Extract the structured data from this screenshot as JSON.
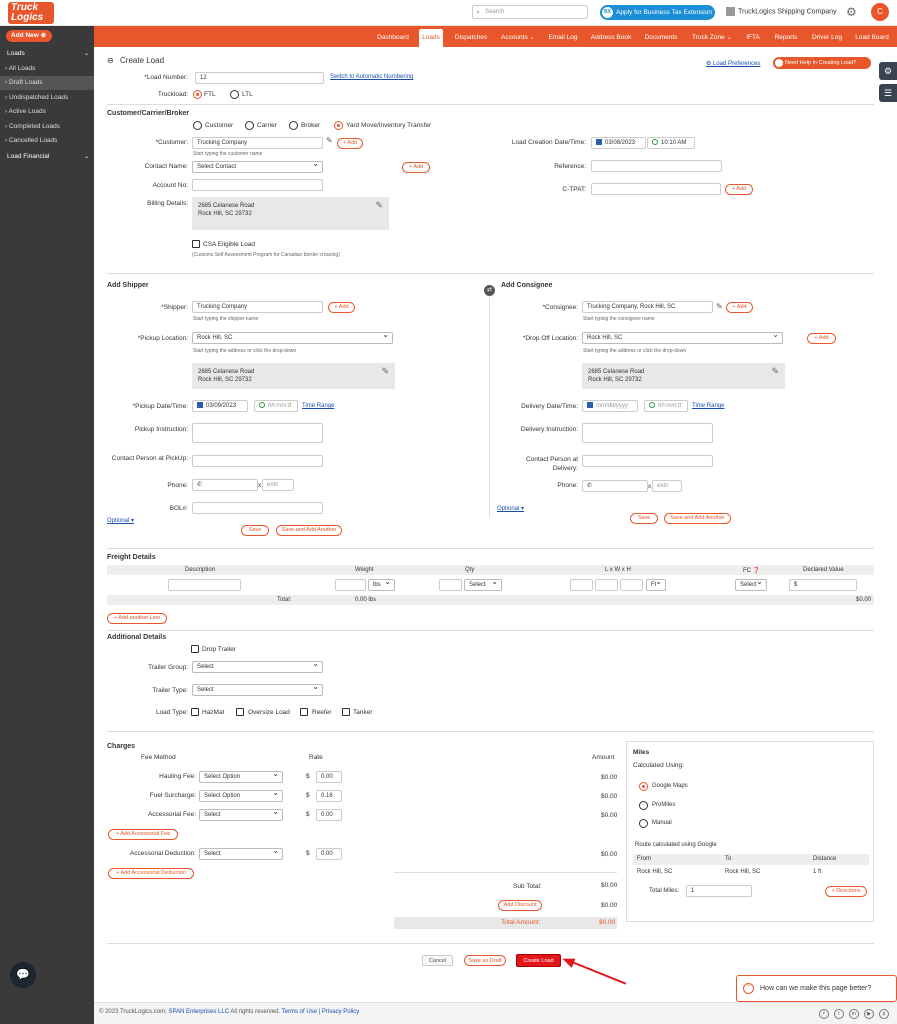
{
  "topbar": {
    "logo": "Truck Logics",
    "search_placeholder": "Search",
    "tax_badge": "BX",
    "tax_button": "Apply for Business Tax Extension",
    "company": "TruckLogics Shipping Company",
    "avatar": "C"
  },
  "sidebar": {
    "add_new": "Add New",
    "items": [
      {
        "label": "Loads",
        "type": "hdr"
      },
      {
        "label": "All Loads",
        "type": "sub"
      },
      {
        "label": "Draft Loads",
        "type": "active"
      },
      {
        "label": "Undispatched Loads",
        "type": "sub"
      },
      {
        "label": "Active Loads",
        "type": "sub"
      },
      {
        "label": "Completed Loads",
        "type": "sub"
      },
      {
        "label": "Cancelled Loads",
        "type": "sub"
      },
      {
        "label": "Load Financial",
        "type": "hdr"
      }
    ]
  },
  "nav": [
    "Dashboard",
    "Loads",
    "Dispatches",
    "Accounts",
    "Email Log",
    "Address Book",
    "Documents",
    "Truck Zone",
    "IFTA",
    "Reports",
    "Driver Log",
    "Load Board"
  ],
  "header": {
    "title": "Create Load",
    "load_prefs": "Load Preferences",
    "help": "Need Help In Creating Load?"
  },
  "load": {
    "number_label": "*Load Number:",
    "number": "12",
    "auto_numbering": "Switch to Automatic Numbering",
    "truckload_label": "Truckload:",
    "ftl": "FTL",
    "ltl": "LTL"
  },
  "customer": {
    "section": "Customer/Carrier/Broker",
    "opt_customer": "Customer",
    "opt_carrier": "Carrier",
    "opt_broker": "Broker",
    "opt_yard": "Yard Move/Inventory Transfer",
    "customer_label": "*Customer:",
    "customer_value": "Trucking Company",
    "customer_hint": "Start typing the customer name",
    "add": "+ Add",
    "contact_label": "Contact Name:",
    "contact_value": "Select Contact",
    "account_label": "Account No:",
    "billing_label": "Billing Details:",
    "billing_l1": "2685 Celanese Road",
    "billing_l2": "Rock Hill, SC 29732",
    "csa_label": "CSA Eligible Load",
    "csa_hint": "(Customs Self Assessment Program for Canadian border crossing)",
    "created_label": "Load Creation Date/Time:",
    "created_date": "03/08/2023",
    "created_time": "10:10 AM",
    "reference_label": "Reference:",
    "ctpat_label": "C-TPAT:"
  },
  "shipper": {
    "section": "Add Shipper",
    "shipper_label": "*Shipper:",
    "shipper_value": "Trucking Company",
    "shipper_hint": "Start typing the shipper name",
    "loc_label": "*Pickup Location:",
    "loc_value": "Rock Hill, SC",
    "loc_hint": "Start typing the address or click the drop-down",
    "addr_l1": "2685 Celanese Road",
    "addr_l2": "Rock Hill, SC 29732",
    "date_label": "*Pickup Date/Time:",
    "date_value": "03/09/2023",
    "time_ph": "hh:mm:tt",
    "time_range": "Time Range",
    "instr_label": "Pickup Instruction:",
    "contact_label": "Contact Person at PickUp:",
    "phone_label": "Phone:",
    "x": "x",
    "ext_ph": "extn",
    "bol_label": "BOL#:",
    "optional": "Optional",
    "save": "Save",
    "save_another": "Save and Add Another"
  },
  "consignee": {
    "section": "Add Consignee",
    "cons_label": "*Consignee:",
    "cons_value": "Trucking Company, Rock Hill, SC",
    "cons_hint": "Start typing the consignee name",
    "loc_label": "*Drop Off Location:",
    "loc_value": "Rock Hill, SC",
    "loc_hint": "Start typing the address or click the drop-down",
    "addr_l1": "2685 Celanese Road",
    "addr_l2": "Rock Hill, SC 29732",
    "date_label": "Delivery Date/Time:",
    "date_ph": "mm/dd/yyyy",
    "time_ph": "hh:mm:tt",
    "time_range": "Time Range",
    "instr_label": "Delivery Instruction:",
    "contact_label1": "Contact Person at",
    "contact_label2": "Delivery:",
    "phone_label": "Phone:",
    "x": "x",
    "ext_ph": "extn",
    "optional": "Optional",
    "save": "Save",
    "save_another": "Save and Add Another"
  },
  "freight": {
    "section": "Freight Details",
    "cols": [
      "Description",
      "Weight",
      "Qty",
      "L x W x H",
      "FC",
      "Declared Value"
    ],
    "weight_unit": "lbs",
    "qty_select": "Select",
    "dim_unit": "Ft",
    "fc_select": "Select",
    "dollar": "$",
    "total_label": "Total:",
    "total_weight": "0.00 lbs",
    "total_value": "$0.00",
    "add_line": "+ Add another Line"
  },
  "additional": {
    "section": "Additional Details",
    "drop_trailer": "Drop Trailer",
    "trailer_group_label": "Trailer Group:",
    "trailer_group": "Select",
    "trailer_type_label": "Trailer Type:",
    "trailer_type": "Select",
    "load_type_label": "Load Type:",
    "types": [
      "HazMat",
      "Oversize Load",
      "Reefer",
      "Tanker"
    ]
  },
  "charges": {
    "section": "Charges",
    "fee_method": "Fee Method",
    "rate": "Rate",
    "amount": "Amount",
    "rows": [
      {
        "label": "Hauling Fee:",
        "method": "Select Option",
        "rate": "0.00",
        "amount": "$0.00"
      },
      {
        "label": "Fuel Surcharge:",
        "method": "Select Option",
        "rate": "0.16",
        "amount": "$0.00"
      },
      {
        "label": "Accessorial Fee:",
        "method": "Select",
        "rate": "0.00",
        "amount": "$0.00"
      },
      {
        "label": "Accessorial Deduction:",
        "method": "Select",
        "rate": "0.00",
        "amount": "$0.00"
      }
    ],
    "add_fee": "+ Add Accessorial Fee",
    "add_deduction": "+ Add Accessorial Deduction",
    "dollar": "$",
    "subtotal_label": "Sub Total:",
    "subtotal": "$0.00",
    "add_discount": "Add Discount",
    "discount": "$0.00",
    "total_label": "Total Amount:",
    "total": "$0.00"
  },
  "miles": {
    "title": "Miles",
    "calc": "Calculated Using:",
    "opts": [
      "Google Maps",
      "ProMiles",
      "Manual"
    ],
    "route": "Route calculated using Google",
    "cols": [
      "From",
      "To",
      "Distance"
    ],
    "from": "Rock Hill, SC",
    "to": "Rock Hill, SC",
    "distance": "1 ft",
    "total_label": "Total Miles:",
    "total": "1",
    "directions": "Directions"
  },
  "actions": {
    "cancel": "Cancel",
    "draft": "Save as Draft",
    "create": "Create Load"
  },
  "footer": {
    "copy": "© 2023 TruckLogics.com,",
    "span": "SPAN Enterprises LLC",
    "rights": "All rights reserved.",
    "terms": "Terms of Use",
    "sep": "|",
    "privacy": "Privacy Policy",
    "social": [
      "f",
      "t",
      "in",
      "▶",
      "p"
    ]
  },
  "feedback": "How can we make this page better?",
  "colors": {
    "brand": "#e8572b",
    "sidebar": "#3a3a3a",
    "link": "#1a4fb0",
    "arrow": "#e3161b"
  }
}
